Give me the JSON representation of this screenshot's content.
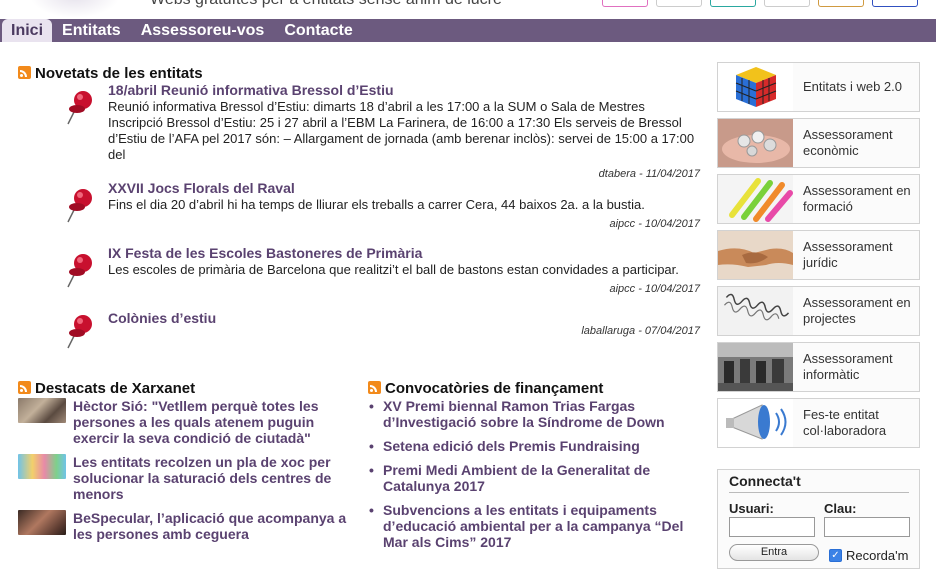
{
  "header": {
    "tagline": "Webs gratuïtes per a entitats sense ànim de lucre",
    "nav": [
      {
        "label": "Inici",
        "active": true
      },
      {
        "label": "Entitats"
      },
      {
        "label": "Assessoreu-vos"
      },
      {
        "label": "Contacte"
      }
    ]
  },
  "news": {
    "title": "Novetats de les entitats",
    "items": [
      {
        "title": "18/abril Reunió informativa Bressol d’Estiu",
        "body": "Reunió informativa Bressol d’Estiu: dimarts 18 d’abril a les 17:00 a la SUM o Sala de Mestres Inscripció Bressol d’Estiu: 25 i 27 abril a l’EBM La Farinera, de 16:00 a 17:30 Els serveis de Bressol d’Estiu de l’AFA pel 2017 són: – Allargament de jornada (amb berenar inclòs): servei de 15:00 a 17:00 del",
        "author": "dtabera",
        "date": " - 11/04/2017"
      },
      {
        "title": "XXVII Jocs Florals del Raval",
        "body": "Fins el dia 20 d’abril hi ha temps de lliurar els treballs a carrer Cera, 44 baixos 2a. a la bustia.",
        "author": "aipcc",
        "date": " - 10/04/2017"
      },
      {
        "title": "IX Festa de les Escoles Bastoneres de Primària",
        "body": "Les escoles de primària de Barcelona que realitzi’t el ball de bastons estan convidades a participar.",
        "author": "aipcc",
        "date": " - 10/04/2017"
      },
      {
        "title": "Colònies d’estiu",
        "body": "",
        "author": "laballaruga",
        "date": " - 07/04/2017"
      }
    ]
  },
  "destacats": {
    "title": "Destacats de Xarxanet",
    "items": [
      {
        "title": "Hèctor Sió: \"Vetllem perquè totes les persones a les quals atenem puguin exercir la seva condició de ciutadà\"",
        "thumb": "meeting-photo"
      },
      {
        "title": "Les entitats recolzen un pla de xoc per solucionar la saturació dels centres de menors",
        "thumb": "children-illustration"
      },
      {
        "title": "BeSpecular, l’aplicació que acompanya a les persones amb ceguera",
        "thumb": "hands-phone-photo"
      }
    ]
  },
  "convocatories": {
    "title": "Convocatòries de finançament",
    "items": [
      "XV Premi biennal Ramon Trias Fargas d’Investigació sobre la Síndrome de Down",
      "Setena edició dels Premis Fundraising",
      "Premi Medi Ambient de la Generalitat de Catalunya 2017",
      "Subvencions a les entitats i equipaments d’educació ambiental per a la campanya “Del Mar als Cims” 2017"
    ]
  },
  "sidebar": {
    "items": [
      {
        "label": "Entitats i web 2.0",
        "icon": "rubik-cube-image"
      },
      {
        "label": "Assessorament econòmic",
        "icon": "coins-image"
      },
      {
        "label": "Assessorament en formació",
        "icon": "highlighters-image"
      },
      {
        "label": "Assessorament jurídic",
        "icon": "handshake-image"
      },
      {
        "label": "Assessorament en projectes",
        "icon": "spiral-spring-image"
      },
      {
        "label": "Assessorament informàtic",
        "icon": "computer-room-image"
      },
      {
        "label": "Fes-te entitat col·laboradora",
        "icon": "megaphone-image"
      }
    ]
  },
  "login": {
    "title": "Connecta't",
    "user_label": "Usuari:",
    "pass_label": "Clau:",
    "submit": "Entra",
    "remember": "Recorda'm"
  },
  "colors": {
    "nav_bg": "#6c5a7f",
    "link": "#5a4270",
    "rss": "#f28a1b"
  }
}
